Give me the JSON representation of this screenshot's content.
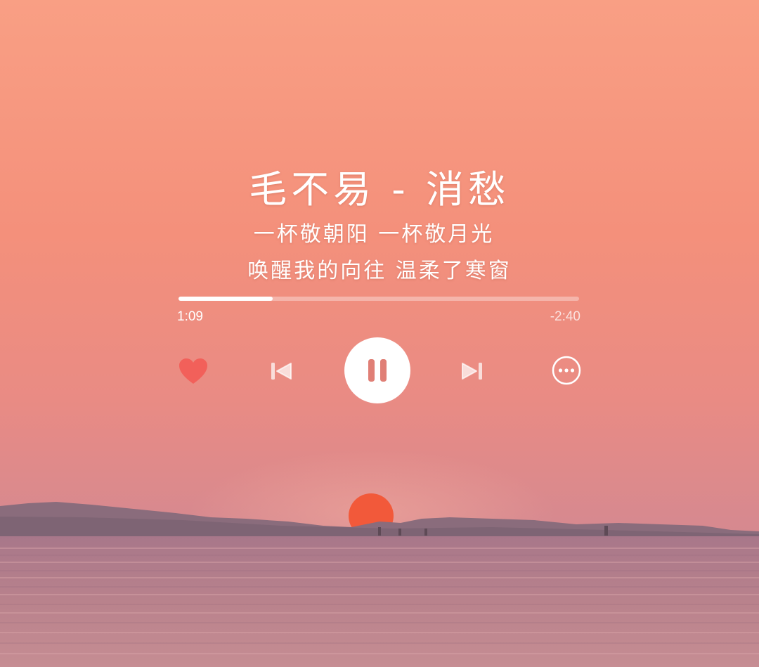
{
  "player": {
    "title": "毛不易 - 消愁",
    "lyrics": [
      "一杯敬朝阳 一杯敬月光",
      "唤醒我的向往 温柔了寒窗"
    ],
    "elapsed": "1:09",
    "remaining": "-2:40",
    "progress": 0.235,
    "liked": true
  },
  "icons": {
    "like": "heart-icon",
    "previous": "skip-previous-icon",
    "play_pause": "pause-icon",
    "next": "skip-next-icon",
    "more": "more-options-icon"
  },
  "colors": {
    "sky_top": "#F99E83",
    "sky_mid": "#F28C7C",
    "horizon": "#D98A8F",
    "sun": "#F2593A",
    "sea": "#B07A88",
    "heart": "#F2605A",
    "pause_glyph": "#E07F76"
  }
}
